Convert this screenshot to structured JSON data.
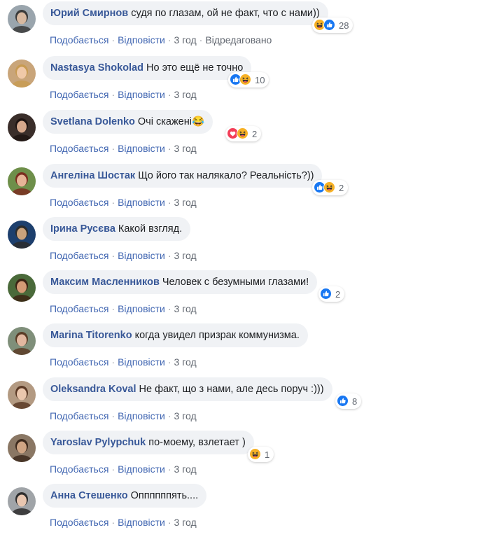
{
  "actions": {
    "like": "Подобається",
    "reply": "Відповісти"
  },
  "colors": {
    "author": "#385898",
    "action_link": "#4267b2",
    "bubble_bg": "#f0f2f5",
    "like": "#1877f2",
    "love": "#f33e58",
    "haha": "#f7b125"
  },
  "comments": [
    {
      "author": "Юрий Смирнов",
      "text": "судя по глазам, ой не факт, что с нами))",
      "time": "3 год",
      "edited": "Відредаговано",
      "reactions": [
        "haha-icon",
        "like-icon"
      ],
      "reaction_count": "28"
    },
    {
      "author": "Nastasya Shokolad",
      "text": "Но это ещё не точно",
      "time": "3 год",
      "edited": "",
      "reactions": [
        "like-icon",
        "haha-icon"
      ],
      "reaction_count": "10"
    },
    {
      "author": "Svetlana Dolenko",
      "text": "Очі скажені😂",
      "time": "3 год",
      "edited": "",
      "reactions": [
        "love-icon",
        "haha-icon"
      ],
      "reaction_count": "2"
    },
    {
      "author": "Ангеліна Шостак",
      "text": "Що його так налякало? Реальність?))",
      "time": "3 год",
      "edited": "",
      "reactions": [
        "like-icon",
        "haha-icon"
      ],
      "reaction_count": "2"
    },
    {
      "author": "Ірина Русєва",
      "text": "Какой взгляд.",
      "time": "3 год",
      "edited": "",
      "reactions": [],
      "reaction_count": ""
    },
    {
      "author": "Максим Масленников",
      "text": "Человек с безумными глазами!",
      "time": "3 год",
      "edited": "",
      "reactions": [
        "like-icon"
      ],
      "reaction_count": "2"
    },
    {
      "author": "Marina Titorenko",
      "text": "когда увидел призрак коммунизма.",
      "time": "3 год",
      "edited": "",
      "reactions": [],
      "reaction_count": ""
    },
    {
      "author": "Oleksandra Koval",
      "text": "Не факт, що з нами, але десь поруч :)))",
      "time": "3 год",
      "edited": "",
      "reactions": [
        "like-icon"
      ],
      "reaction_count": "8"
    },
    {
      "author": "Yaroslav Pylypchuk",
      "text": "по-моему, взлетает )",
      "time": "3 год",
      "edited": "",
      "reactions": [
        "haha-icon"
      ],
      "reaction_count": "1"
    },
    {
      "author": "Анна Стешенко",
      "text": "Оппппппять....",
      "time": "3 год",
      "edited": "",
      "reactions": [],
      "reaction_count": ""
    }
  ]
}
